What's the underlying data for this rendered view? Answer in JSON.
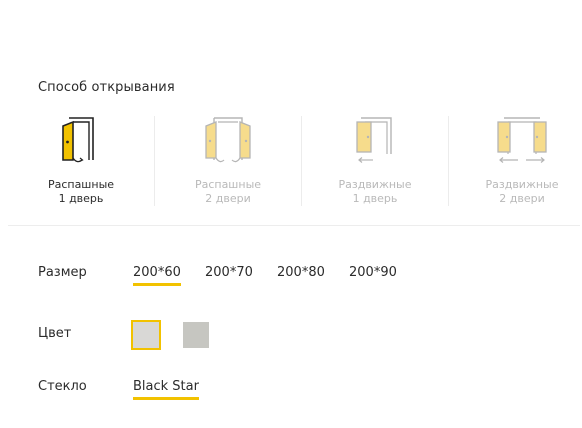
{
  "opening": {
    "title": "Способ открывания",
    "options": [
      {
        "line1": "Распашные",
        "line2": "1 дверь",
        "icon": "swing-single-door-icon",
        "enabled": true
      },
      {
        "line1": "Распашные",
        "line2": "2 двери",
        "icon": "swing-double-door-icon",
        "enabled": false
      },
      {
        "line1": "Раздвижные",
        "line2": "1 дверь",
        "icon": "sliding-single-door-icon",
        "enabled": false
      },
      {
        "line1": "Раздвижные",
        "line2": "2 двери",
        "icon": "sliding-double-door-icon",
        "enabled": false
      }
    ]
  },
  "size": {
    "label": "Размер",
    "options": [
      "200*60",
      "200*70",
      "200*80",
      "200*90"
    ],
    "selected": "200*60"
  },
  "color": {
    "label": "Цвет",
    "swatches": [
      {
        "name": "light-grey",
        "hex": "#d9d8d6",
        "selected": true
      },
      {
        "name": "grey",
        "hex": "#c6c6c1",
        "selected": false
      }
    ]
  },
  "glass": {
    "label": "Стекло",
    "value": "Black Star"
  },
  "colors": {
    "accent": "#f2c200",
    "door_fill": "#f6dc8c",
    "text": "#2b2b2b",
    "disabled_text": "#b9b9b9"
  }
}
